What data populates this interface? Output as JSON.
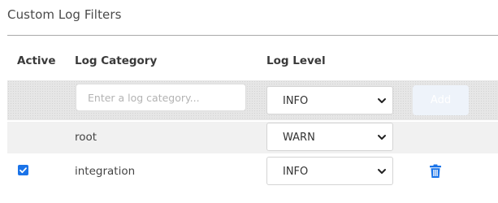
{
  "panel": {
    "title": "Custom Log Filters"
  },
  "table": {
    "columns": {
      "active": "Active",
      "category": "Log Category",
      "level": "Log Level"
    },
    "new_row": {
      "category_placeholder": "Enter a log category...",
      "category_value": "",
      "level": "INFO",
      "add_label": "Add",
      "add_enabled": false
    },
    "rows": [
      {
        "active": null,
        "category": "root",
        "level": "WARN",
        "deletable": false
      },
      {
        "active": true,
        "category": "integration",
        "level": "INFO",
        "deletable": true
      }
    ]
  },
  "colors": {
    "accent": "#1a73e8",
    "add_button_disabled_bg": "#eef3fa",
    "header_rule": "#a9a9a9"
  },
  "icons": {
    "checkbox": "checkbox-checked-icon",
    "delete": "trash-icon",
    "dropdown": "chevron-down-icon"
  }
}
